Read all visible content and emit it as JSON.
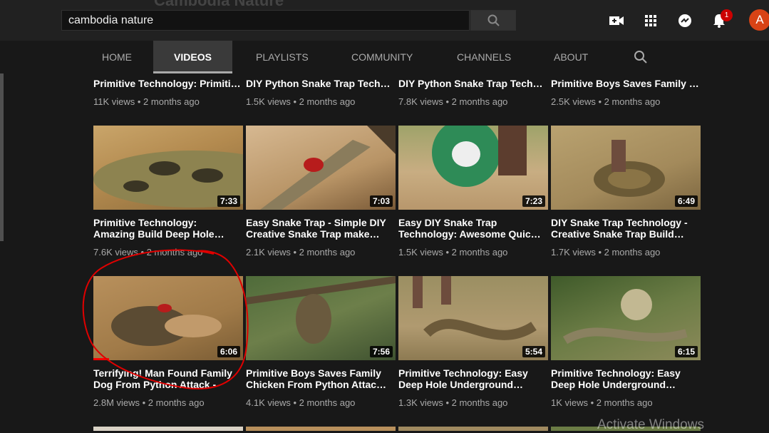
{
  "header": {
    "background_title": "Cambodia Nature",
    "search_value": "cambodia nature",
    "notification_count": "1",
    "avatar_letter": "A"
  },
  "tabs": [
    "HOME",
    "VIDEOS",
    "PLAYLISTS",
    "COMMUNITY",
    "CHANNELS",
    "ABOUT"
  ],
  "row0": [
    {
      "title": "Primitive Technology: Primitive Man Saves pig…",
      "meta": "11K views • 2 months ago"
    },
    {
      "title": "DIY Python Snake Trap Technology - Creative Snak…",
      "meta": "1.5K views • 2 months ago"
    },
    {
      "title": "DIY Python Snake Trap Technology - Simple DIY…",
      "meta": "7.8K views • 2 months ago"
    },
    {
      "title": "Primitive Boys Saves Family Chicken From Attack -…",
      "meta": "2.5K views • 2 months ago"
    }
  ],
  "row1": [
    {
      "title1": "Primitive Technology:",
      "title2": "Amazing Build Deep Hole…",
      "meta": "7.6K views • 2 months ago",
      "duration": "7:33"
    },
    {
      "title1": "Easy Snake Trap - Simple DIY",
      "title2": "Creative Snake Trap make…",
      "meta": "2.1K views • 2 months ago",
      "duration": "7:03"
    },
    {
      "title1": "Easy DIY Snake Trap",
      "title2": "Technology: Awesome Quic…",
      "meta": "1.5K views • 2 months ago",
      "duration": "7:23"
    },
    {
      "title1": "DIY Snake Trap Technology -",
      "title2": "Creative Snake Trap Build…",
      "meta": "1.7K views • 2 months ago",
      "duration": "6:49"
    }
  ],
  "row2": [
    {
      "title1": "Terrifying! Man Found Family",
      "title2": "Dog From Python Attack -",
      "meta": "2.8M views • 2 months ago",
      "duration": "6:06"
    },
    {
      "title1": "Primitive Boys Saves Family",
      "title2": "Chicken From Python Attac…",
      "meta": "4.1K views • 2 months ago",
      "duration": "7:56"
    },
    {
      "title1": "Primitive Technology: Easy",
      "title2": "Deep Hole Underground…",
      "meta": "1.3K views • 2 months ago",
      "duration": "5:54"
    },
    {
      "title1": "Primitive Technology: Easy",
      "title2": "Deep Hole Underground…",
      "meta": "1K views • 2 months ago",
      "duration": "6:15"
    }
  ],
  "overlay": {
    "watermark": "Activate Windows",
    "annotation_color": "#e00000"
  },
  "colors": {
    "bg": "#181818",
    "header": "#212121",
    "accent": "#ff0000"
  }
}
